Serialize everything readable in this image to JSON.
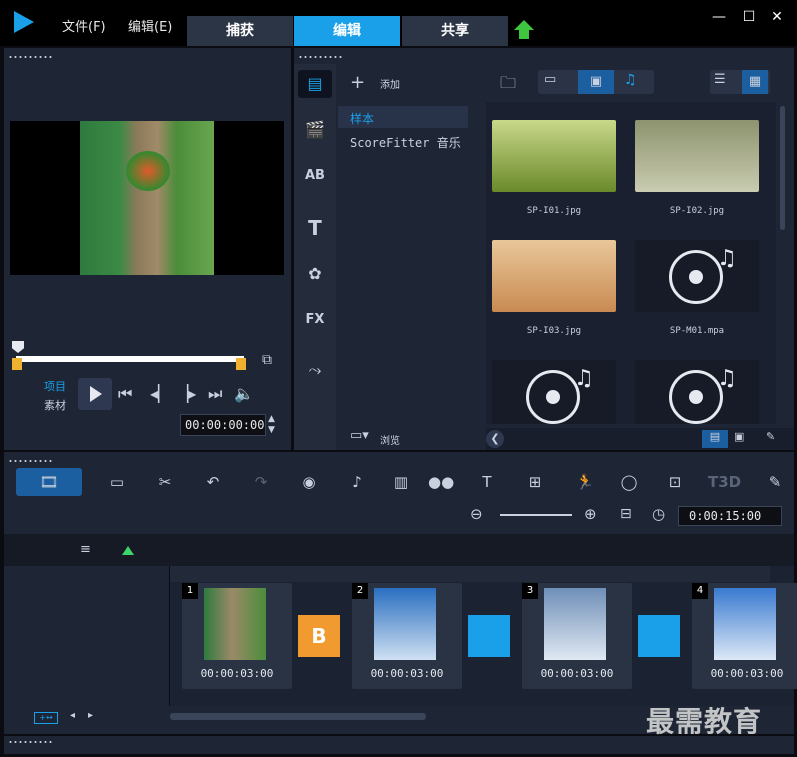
{
  "menu": {
    "file": "文件(F)",
    "edit": "编辑(E)"
  },
  "tabs": [
    "捕获",
    "编辑",
    "共享"
  ],
  "window": {
    "min": "—",
    "max": "☐",
    "close": "✕"
  },
  "player": {
    "project_label": "项目",
    "clip_label": "素材",
    "timecode": "00:00:00:00"
  },
  "library": {
    "add_label": "添加",
    "folders": [
      "样本",
      "ScoreFitter 音乐"
    ],
    "browse_label": "浏览",
    "media": [
      {
        "file": "SP-I01.jpg",
        "kind": "image",
        "colors": [
          "#6a8a2a",
          "#c9d88a"
        ]
      },
      {
        "file": "SP-I02.jpg",
        "kind": "image",
        "colors": [
          "#c9ccb0",
          "#8d936e"
        ]
      },
      {
        "file": "SP-I03.jpg",
        "kind": "image",
        "colors": [
          "#c98a52",
          "#e9c79a"
        ]
      },
      {
        "file": "SP-M01.mpa",
        "kind": "audio",
        "colors": [
          "#1a2030",
          "#1a2030"
        ]
      },
      {
        "file": "",
        "kind": "audio",
        "colors": [
          "#1a2030",
          "#1a2030"
        ]
      },
      {
        "file": "",
        "kind": "audio",
        "colors": [
          "#1a2030",
          "#1a2030"
        ]
      }
    ]
  },
  "timeline": {
    "duration": "0:00:15:00",
    "clips": [
      {
        "num": "1",
        "time": "00:00:03:00"
      },
      {
        "num": "2",
        "time": "00:00:03:00"
      },
      {
        "num": "3",
        "time": "00:00:03:00"
      },
      {
        "num": "4",
        "time": "00:00:03:00"
      }
    ],
    "transitions": [
      "B",
      "",
      ""
    ]
  },
  "watermark": "最需教育",
  "colors": {
    "accent": "#1aa0e8",
    "panel": "#1e2535",
    "bg": "#0a0c12"
  },
  "icons": [
    "play-icon",
    "prev-icon",
    "next-icon",
    "volume-icon",
    "undo-icon",
    "redo-icon",
    "record-icon",
    "audio-icon",
    "title-icon",
    "motion-icon",
    "folder-icon"
  ]
}
